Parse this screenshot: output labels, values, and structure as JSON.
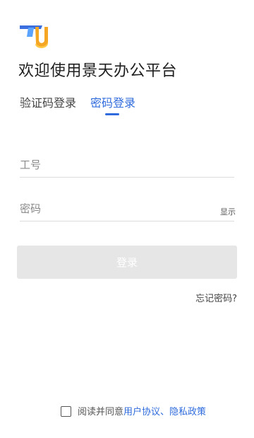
{
  "logo": {
    "icon": "tu-logo-icon",
    "colors": {
      "primary_blue": "#2f6bdc",
      "accent_orange": "#f5a623",
      "accent_yellow": "#ffc94a"
    }
  },
  "title": "欢迎使用景天办公平台",
  "tabs": [
    {
      "label": "验证码登录",
      "active": false
    },
    {
      "label": "密码登录",
      "active": true
    }
  ],
  "fields": {
    "employee_id": {
      "placeholder": "工号",
      "value": ""
    },
    "password": {
      "placeholder": "密码",
      "value": "",
      "toggle_label": "显示"
    }
  },
  "login_button": {
    "label": "登录",
    "enabled": false
  },
  "forgot_password": "忘记密码?",
  "agreement": {
    "checked": false,
    "prefix": "阅读并同意",
    "user_agreement": "用户协议",
    "separator": "、",
    "privacy_policy": "隐私政策"
  },
  "colors": {
    "accent": "#2f6bdc",
    "disabled_button": "#e6e6e6",
    "divider": "#dcdcdc"
  }
}
